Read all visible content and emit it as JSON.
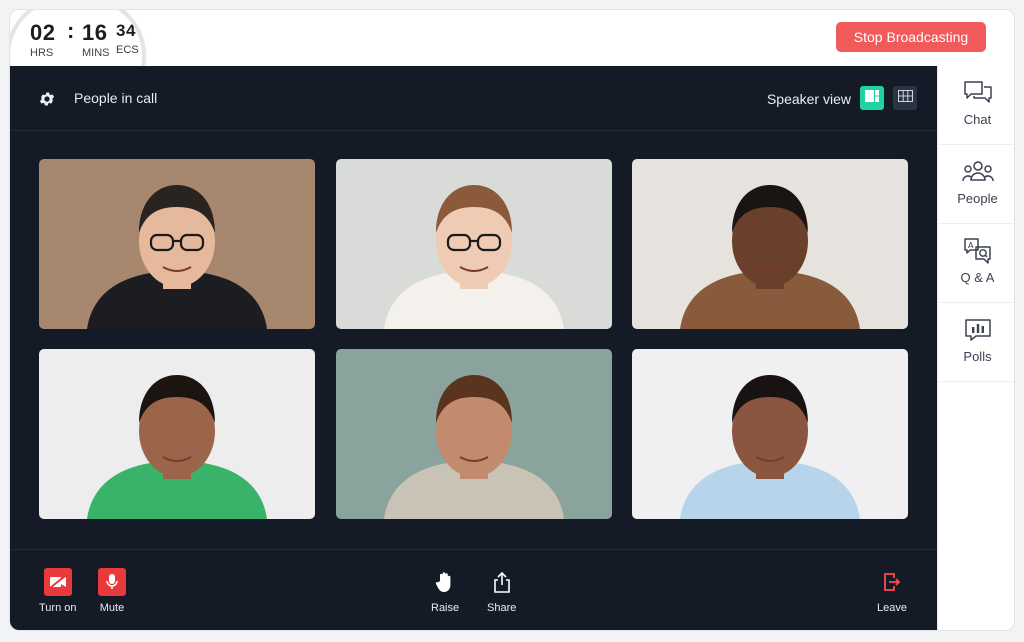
{
  "timer": {
    "hours": "02",
    "hours_label": "HRS",
    "separator": ":",
    "minutes": "16",
    "minutes_label": "MINS",
    "seconds": "34",
    "seconds_label": "ECS"
  },
  "header": {
    "stop_label": "Stop Broadcasting"
  },
  "stage": {
    "people_label": "People in call",
    "view_label": "Speaker view"
  },
  "participants": [
    {
      "name": "participant-1",
      "bg": "#a7876e",
      "skin": "#e6b99c",
      "hair": "#2a2420",
      "shirt": "#1c1d22",
      "glasses": true
    },
    {
      "name": "participant-2",
      "bg": "#d9dbd9",
      "skin": "#efcbb4",
      "hair": "#8a5a3a",
      "shirt": "#f4f1ec",
      "glasses": true
    },
    {
      "name": "participant-3",
      "bg": "#e6e3df",
      "skin": "#6a3f2b",
      "hair": "#1a1412",
      "shirt": "#8a5a3c",
      "glasses": false
    },
    {
      "name": "participant-4",
      "bg": "#ededee",
      "skin": "#9a6548",
      "hair": "#1c1411",
      "shirt": "#39b36a",
      "glasses": false
    },
    {
      "name": "participant-5",
      "bg": "#8aa39c",
      "skin": "#c38b6e",
      "hair": "#5a341f",
      "shirt": "#c9c3b6",
      "glasses": false
    },
    {
      "name": "participant-6",
      "bg": "#f0f0f2",
      "skin": "#8a5640",
      "hair": "#181312",
      "shirt": "#b7d4ea",
      "glasses": false
    }
  ],
  "controls": {
    "video_label": "Turn on",
    "mute_label": "Mute",
    "raise_label": "Raise",
    "share_label": "Share",
    "leave_label": "Leave"
  },
  "sidebar": {
    "items": [
      {
        "label": "Chat",
        "icon": "chat-icon"
      },
      {
        "label": "People",
        "icon": "people-icon"
      },
      {
        "label": "Q & A",
        "icon": "qa-icon"
      },
      {
        "label": "Polls",
        "icon": "polls-icon"
      }
    ]
  },
  "colors": {
    "stage_bg": "#141b26",
    "accent_red": "#f05a5a",
    "accent_green": "#1ed3a4"
  }
}
